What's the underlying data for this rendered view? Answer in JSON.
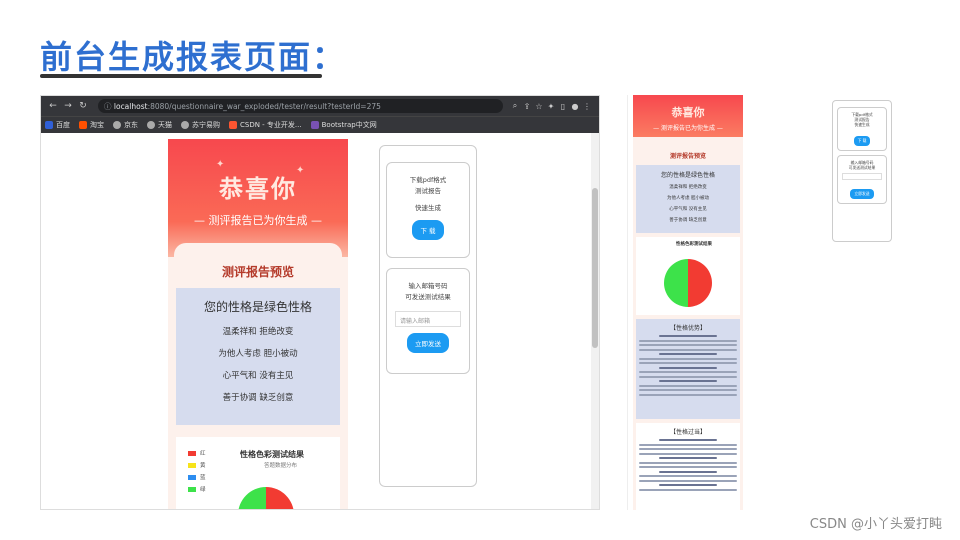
{
  "slide": {
    "title": "前台生成报表页面："
  },
  "browser": {
    "url_host": "localhost",
    "url_rest": ":8080/questionnaire_war_exploded/tester/result?testerId=275",
    "bookmarks": [
      {
        "label": "百度",
        "color": "#3060d8"
      },
      {
        "label": "淘宝",
        "color": "#ff5000"
      },
      {
        "label": "京东",
        "color": "#aaaaaa"
      },
      {
        "label": "天猫",
        "color": "#aaaaaa"
      },
      {
        "label": "苏宁易购",
        "color": "#aaaaaa"
      },
      {
        "label": "CSDN - 专业开发...",
        "color": "#fc5531"
      },
      {
        "label": "Bootstrap中文网",
        "color": "#7952b3"
      }
    ]
  },
  "report": {
    "banner_title": "恭喜你",
    "banner_sub": "— 测评报告已为你生成 —",
    "preview_head": "测评报告预览",
    "trait_main": "您的性格是绿色性格",
    "trait_lines": [
      "温柔祥和 拒绝改变",
      "为他人考虑 胆小被动",
      "心平气和 没有主见",
      "善于协调 缺乏创意"
    ],
    "chart_title": "性格色彩测试结果",
    "chart_sub": "答题数据分布",
    "legend": [
      {
        "label": "红",
        "color": "#f23b32"
      },
      {
        "label": "黄",
        "color": "#f7e31a"
      },
      {
        "label": "蓝",
        "color": "#2d8df0"
      },
      {
        "label": "绿",
        "color": "#3de24a"
      }
    ]
  },
  "panel": {
    "download_text_1": "下载pdf格式",
    "download_text_2": "测试报告",
    "download_text_3": "快速生成",
    "download_btn": "下 载",
    "email_text_1": "输入邮箱号码",
    "email_text_2": "可发送测试结果",
    "email_placeholder": "请输入邮箱",
    "email_btn": "立即发送"
  },
  "mobile": {
    "banner_title": "恭喜你",
    "banner_sub": "— 测评报告已为你生成 —",
    "preview_head": "测评报告预览",
    "trait_main": "您的性格是绿色性格",
    "trait_lines": [
      "温柔祥和 拒绝改变",
      "为他人考虑 胆小被动",
      "心平气和 没有主见",
      "善于协调 缺乏创意"
    ],
    "chart_title": "性格色彩测试结果",
    "block1_title": "【性格优势】",
    "block2_title": "【性格过当】",
    "panel_text_1": "下载pdf格式",
    "panel_text_2": "测试报告",
    "panel_text_3": "快速生成",
    "panel_btn_1": "下 载",
    "panel_text_4": "输入邮箱号码",
    "panel_text_5": "可发送测试结果",
    "panel_btn_2": "立即发送"
  },
  "chart_data": {
    "type": "pie",
    "categories": [
      "红",
      "黄",
      "蓝",
      "绿"
    ],
    "values": [
      50,
      0,
      0,
      50
    ],
    "colors": [
      "#f23b32",
      "#f7e31a",
      "#2d8df0",
      "#3de24a"
    ],
    "title": "性格色彩测试结果",
    "subtitle": "答题数据分布"
  },
  "watermark": "CSDN @小丫头爱打盹"
}
